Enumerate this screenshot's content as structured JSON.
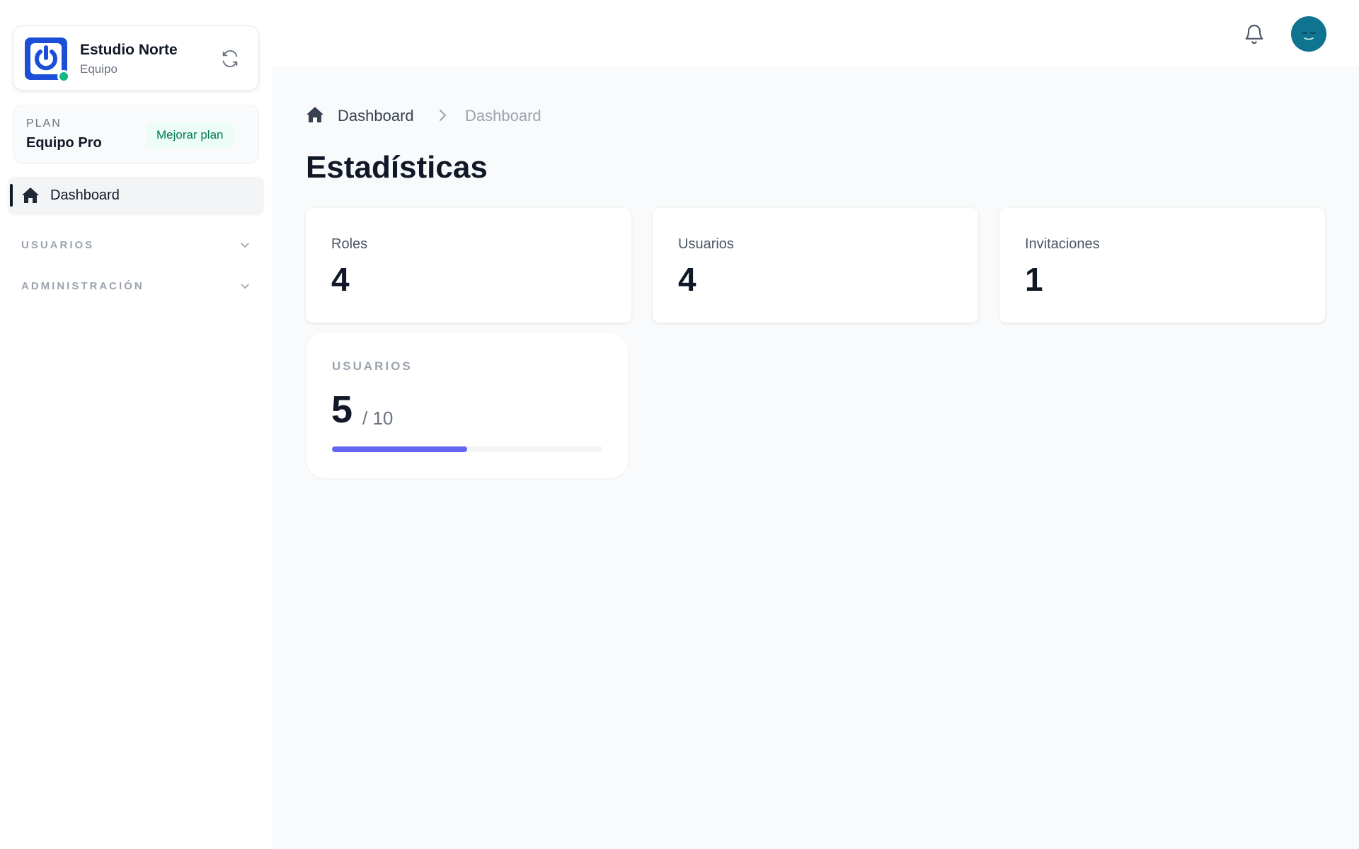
{
  "org": {
    "name": "Estudio Norte",
    "type": "Equipo",
    "status_color": "#10b981",
    "logo_color": "#1d4ed8"
  },
  "plan": {
    "label": "PLAN",
    "name": "Equipo Pro",
    "upgrade_label": "Mejorar plan"
  },
  "sidebar": {
    "active_item": {
      "label": "Dashboard",
      "icon": "home-icon"
    },
    "sections": [
      {
        "label": "USUARIOS",
        "icon": "chevron-down-icon"
      },
      {
        "label": "ADMINISTRACIÓN",
        "icon": "chevron-down-icon"
      }
    ]
  },
  "topbar": {
    "notification_icon": "bell-icon",
    "avatar_color": "#0e7490"
  },
  "breadcrumb": {
    "items": [
      "Dashboard",
      "Dashboard"
    ]
  },
  "page": {
    "title": "Estadísticas"
  },
  "stats": [
    {
      "label": "Roles",
      "value": "4"
    },
    {
      "label": "Usuarios",
      "value": "4"
    },
    {
      "label": "Invitaciones",
      "value": "1"
    }
  ],
  "usage": {
    "label": "USUARIOS",
    "current": "5",
    "max_text": "/ 10",
    "fraction": 0.5,
    "bar_color": "#6366f1"
  }
}
